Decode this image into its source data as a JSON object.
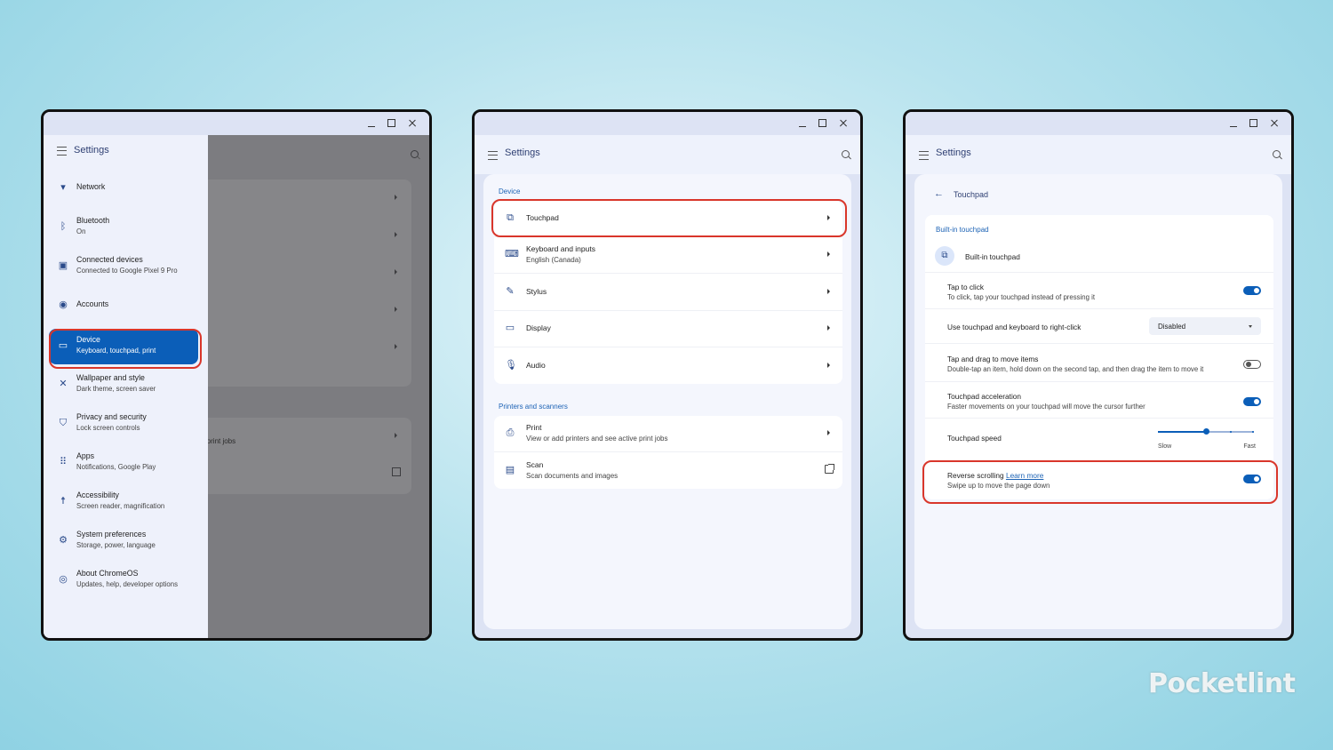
{
  "settings_title": "Settings",
  "window1": {
    "nav_items": [
      {
        "label": "Network",
        "sub": "",
        "icon": "wifi-icon"
      },
      {
        "label": "Bluetooth",
        "sub": "On",
        "icon": "bluetooth-icon"
      },
      {
        "label": "Connected devices",
        "sub": "Connected to Google Pixel 9 Pro",
        "icon": "connected-devices-icon"
      },
      {
        "label": "Accounts",
        "sub": "",
        "icon": "account-icon"
      },
      {
        "label": "Device",
        "sub": "Keyboard, touchpad, print",
        "icon": "laptop-icon"
      },
      {
        "label": "Wallpaper and style",
        "sub": "Dark theme, screen saver",
        "icon": "palette-icon"
      },
      {
        "label": "Privacy and security",
        "sub": "Lock screen controls",
        "icon": "shield-icon"
      },
      {
        "label": "Apps",
        "sub": "Notifications, Google Play",
        "icon": "apps-grid-icon"
      },
      {
        "label": "Accessibility",
        "sub": "Screen reader, magnification",
        "icon": "accessibility-icon"
      },
      {
        "label": "System preferences",
        "sub": "Storage, power, language",
        "icon": "gear-icon"
      },
      {
        "label": "About ChromeOS",
        "sub": "Updates, help, developer options",
        "icon": "chromeos-icon"
      }
    ],
    "background_partial_text": "e print jobs"
  },
  "window2": {
    "device_section": "Device",
    "device_rows": [
      {
        "label": "Touchpad",
        "sub": "",
        "icon": "touchpad-icon"
      },
      {
        "label": "Keyboard and inputs",
        "sub": "English (Canada)",
        "icon": "keyboard-icon"
      },
      {
        "label": "Stylus",
        "sub": "",
        "icon": "stylus-icon"
      },
      {
        "label": "Display",
        "sub": "",
        "icon": "display-icon"
      },
      {
        "label": "Audio",
        "sub": "",
        "icon": "microphone-icon"
      }
    ],
    "printers_section": "Printers and scanners",
    "printer_rows": [
      {
        "label": "Print",
        "sub": "View or add printers and see active print jobs",
        "icon": "printer-icon"
      },
      {
        "label": "Scan",
        "sub": "Scan documents and images",
        "icon": "scanner-icon"
      }
    ]
  },
  "window3": {
    "page_title": "Touchpad",
    "section": "Built-in touchpad",
    "device_name": "Built-in touchpad",
    "tap_to_click": {
      "label": "Tap to click",
      "sub": "To click, tap your touchpad instead of pressing it",
      "on": true
    },
    "right_click": {
      "label": "Use touchpad and keyboard to right-click",
      "value": "Disabled"
    },
    "tap_drag": {
      "label": "Tap and drag to move items",
      "sub": "Double-tap an item, hold down on the second tap, and then drag the item to move it",
      "on": false
    },
    "acceleration": {
      "label": "Touchpad acceleration",
      "sub": "Faster movements on your touchpad will move the cursor further",
      "on": true
    },
    "speed": {
      "label": "Touchpad speed",
      "min_label": "Slow",
      "max_label": "Fast",
      "value_fraction": 0.5
    },
    "reverse_scrolling": {
      "label": "Reverse scrolling",
      "link": "Learn more",
      "sub": "Swipe up to move the page down",
      "on": true
    }
  },
  "colors": {
    "accent": "#0b5eb8",
    "highlight": "#d9362b"
  },
  "watermark": "Pocketlint"
}
